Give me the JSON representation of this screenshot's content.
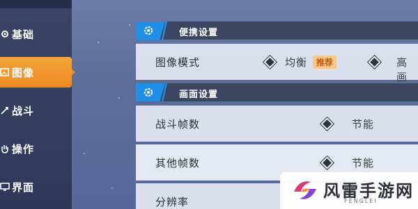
{
  "sidebar": {
    "items": [
      {
        "label": "基础",
        "icon": "gear-icon",
        "active": false
      },
      {
        "label": "图像",
        "icon": "image-icon",
        "active": true
      },
      {
        "label": "战斗",
        "icon": "sword-icon",
        "active": false
      },
      {
        "label": "操作",
        "icon": "hand-icon",
        "active": false
      },
      {
        "label": "界面",
        "icon": "monitor-icon",
        "active": false
      }
    ]
  },
  "sections": [
    {
      "title": "便携设置",
      "rows": [
        {
          "label": "图像模式",
          "options": [
            {
              "text": "均衡",
              "badge": "推荐",
              "selected": true
            },
            {
              "text": "高画",
              "selected": false
            }
          ]
        }
      ]
    },
    {
      "title": "画面设置",
      "rows": [
        {
          "label": "战斗帧数",
          "value": "节能"
        },
        {
          "label": "其他帧数",
          "value": "节能"
        },
        {
          "label": "分辨率",
          "value": ""
        }
      ]
    }
  ],
  "watermark": {
    "title": "风雷手游网",
    "subtitle": "FENGLEI"
  },
  "colors": {
    "accent_orange": "#f08a24",
    "header_blue": "#1f8fe8",
    "sidebar_bg": "#3a4466",
    "badge_bg": "#f7c98d"
  }
}
